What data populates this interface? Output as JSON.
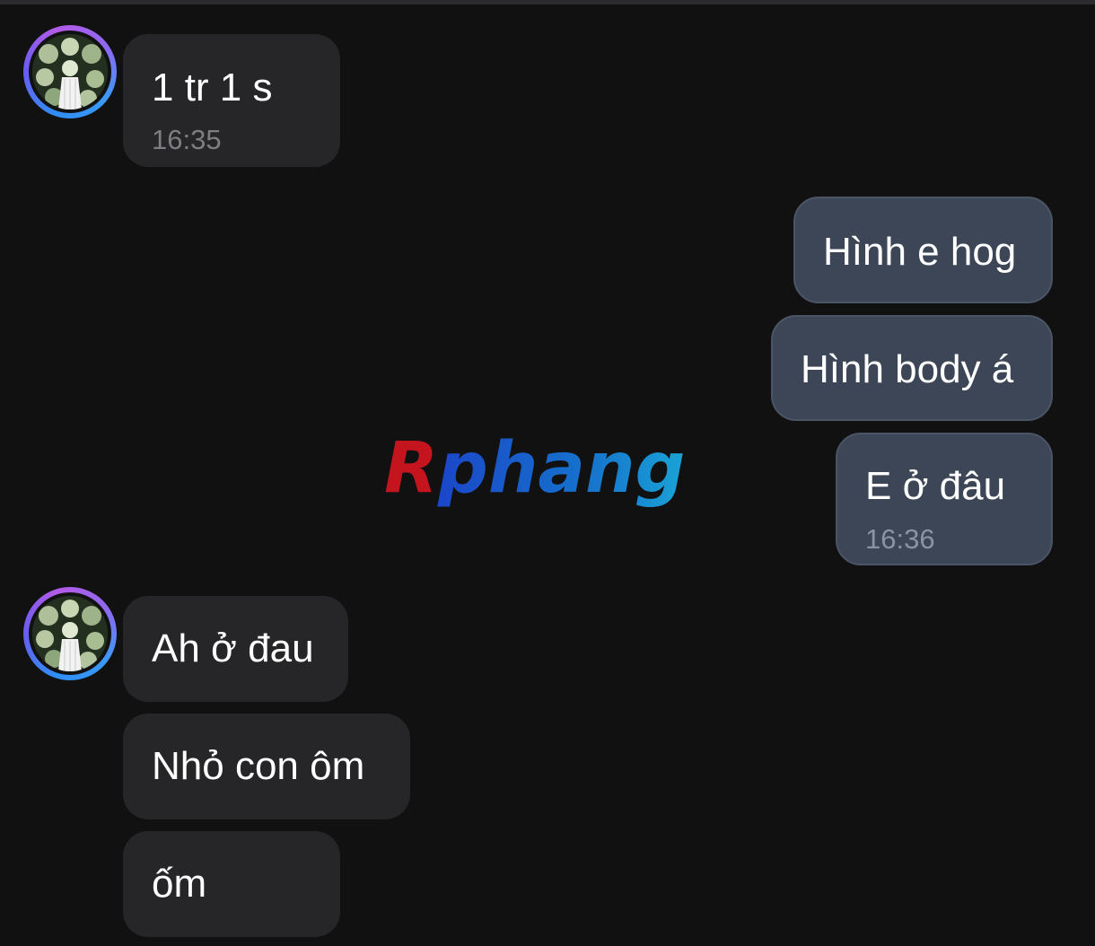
{
  "watermark": {
    "text": "Rphang",
    "letter_r": "R",
    "rest": "phang",
    "colors": [
      "#c4151f",
      "#1b46c9",
      "#1aa3d6"
    ]
  },
  "messages": [
    {
      "side": "incoming",
      "text": "1 tr 1 s",
      "time": "16:35"
    },
    {
      "side": "outgoing",
      "text": "Hình e hog"
    },
    {
      "side": "outgoing",
      "text": "Hình body á"
    },
    {
      "side": "outgoing",
      "text": "E ở đâu",
      "time": "16:36"
    },
    {
      "side": "incoming",
      "text": "Ah ở đau"
    },
    {
      "side": "incoming",
      "text": "Nhỏ con ôm"
    },
    {
      "side": "incoming",
      "text": "ốm"
    }
  ],
  "colors": {
    "background": "#111112",
    "incoming_bubble": "#262628",
    "outgoing_bubble": "#3d4656",
    "avatar_ring": [
      "#2f8df5",
      "#b35be8"
    ]
  },
  "icons": {
    "avatar": "contact-avatar-flowers"
  }
}
